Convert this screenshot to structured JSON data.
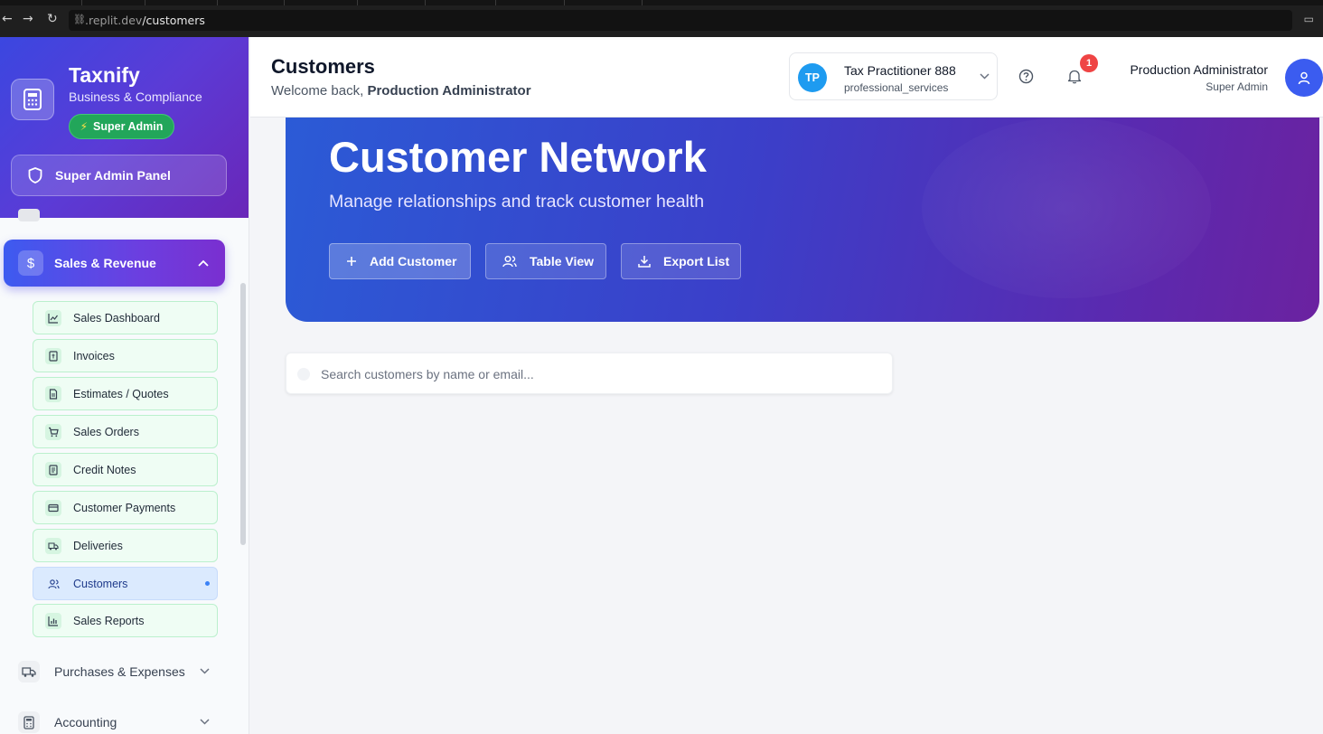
{
  "browser": {
    "url_prefix": ".replit.dev",
    "url_path": "/customers"
  },
  "sidebar": {
    "brand": "Taxnify",
    "brand_subtitle": "Business & Compliance",
    "role_badge": "Super Admin",
    "panel_button": "Super Admin Panel",
    "active_group": "Sales & Revenue",
    "sub_items": [
      {
        "label": "Sales Dashboard",
        "icon": "chart-line-icon"
      },
      {
        "label": "Invoices",
        "icon": "invoice-icon"
      },
      {
        "label": "Estimates / Quotes",
        "icon": "document-icon"
      },
      {
        "label": "Sales Orders",
        "icon": "cart-icon"
      },
      {
        "label": "Credit Notes",
        "icon": "credit-note-icon"
      },
      {
        "label": "Customer Payments",
        "icon": "credit-card-icon"
      },
      {
        "label": "Deliveries",
        "icon": "truck-icon"
      },
      {
        "label": "Customers",
        "icon": "users-icon",
        "active": true
      },
      {
        "label": "Sales Reports",
        "icon": "bar-chart-icon"
      }
    ],
    "groups": [
      {
        "label": "Purchases & Expenses",
        "icon": "truck-icon"
      },
      {
        "label": "Accounting",
        "icon": "calculator-icon"
      }
    ]
  },
  "header": {
    "title": "Customers",
    "welcome_prefix": "Welcome back, ",
    "welcome_name": "Production Administrator",
    "tenant": {
      "initials": "TP",
      "name": "Tax Practitioner 888",
      "type": "professional_services"
    },
    "notification_count": "1",
    "user_name": "Production Administrator",
    "user_role": "Super Admin"
  },
  "hero": {
    "title": "Customer Network",
    "subtitle": "Manage relationships and track customer health",
    "buttons": {
      "add": "Add Customer",
      "table": "Table View",
      "export": "Export List"
    }
  },
  "search": {
    "placeholder": "Search customers by name or email..."
  },
  "colors": {
    "accent": "#3b47e0",
    "accent_purple": "#6a26b8",
    "badge_green": "#22a65a",
    "notification_red": "#ef4444",
    "sub_item_bg": "#effdf4",
    "active_item_bg": "#dbeafe"
  }
}
